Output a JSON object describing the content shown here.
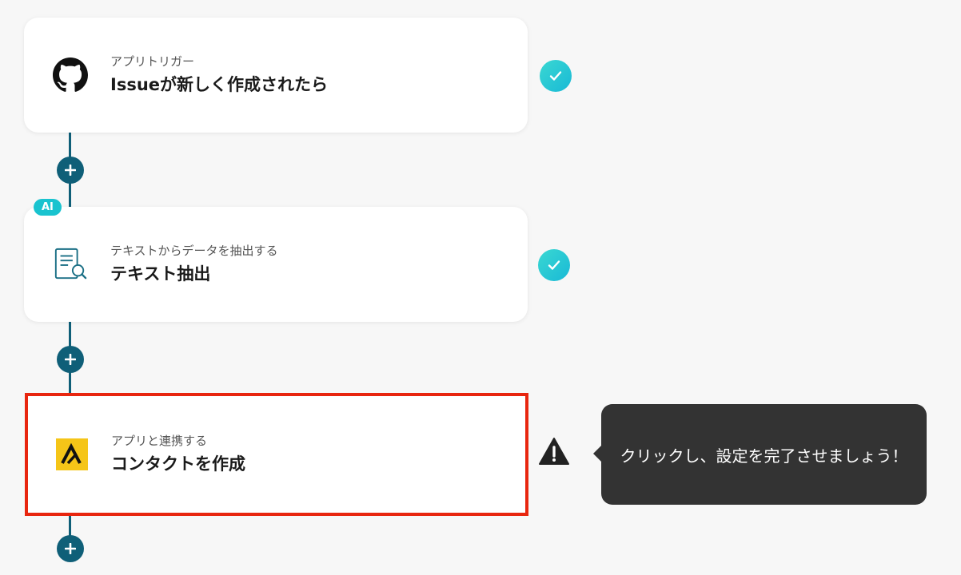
{
  "steps": [
    {
      "subtitle": "アプリトリガー",
      "title": "Issueが新しく作成されたら",
      "icon": "github-icon",
      "status": "completed"
    },
    {
      "badge": "AI",
      "subtitle": "テキストからデータを抽出する",
      "title": "テキスト抽出",
      "icon": "document-search-icon",
      "status": "completed"
    },
    {
      "subtitle": "アプリと連携する",
      "title": "コンタクトを作成",
      "icon": "app-logo-icon",
      "status": "warning"
    }
  ],
  "tooltip": {
    "text": "クリックし、設定を完了させましょう！"
  },
  "colors": {
    "connector": "#0f5f78",
    "check": "#19c3cf",
    "highlight_border": "#e8260f",
    "tooltip_bg": "#333333",
    "app_logo_bg": "#f5c518"
  }
}
